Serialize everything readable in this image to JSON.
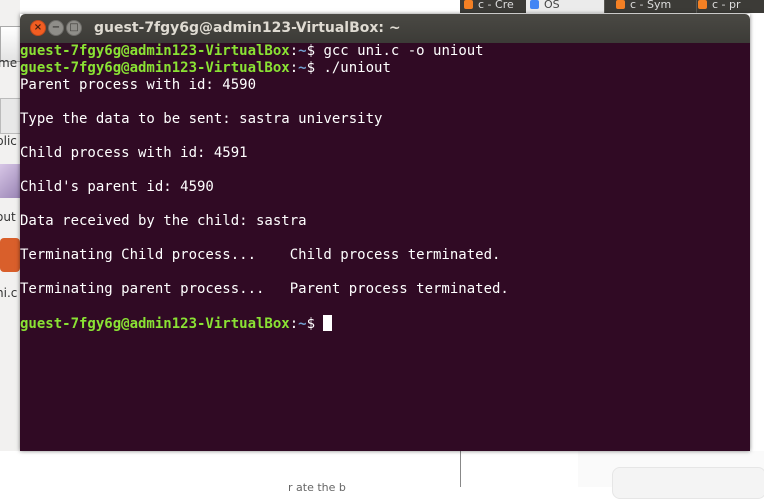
{
  "window": {
    "title": "guest-7fgy6g@admin123-VirtualBox: ~",
    "close_glyph": "×",
    "min_glyph": "−",
    "max_glyph": "□"
  },
  "terminal": {
    "prompt_user_host": "guest-7fgy6g@admin123-VirtualBox",
    "prompt_separator": ":",
    "prompt_path": "~",
    "prompt_symbol": "$ ",
    "commands": [
      "gcc uni.c -o uniout",
      "./uniout"
    ],
    "output": [
      "Parent process with id: 4590",
      "",
      "Type the data to be sent: sastra university",
      "",
      "Child process with id: 4591",
      "",
      "Child's parent id: 4590",
      "",
      "Data received by the child: sastra",
      "",
      "Terminating Child process...    Child process terminated.",
      "",
      "Terminating parent process...   Parent process terminated.",
      ""
    ]
  },
  "background": {
    "desktop_labels": [
      "me",
      "blic",
      "out",
      "ni.c"
    ],
    "browser_tabs": [
      "c - Cre",
      "OS",
      "c - Sym",
      "c - pr"
    ],
    "bottom_text": "r   ate   the   b"
  },
  "colors": {
    "terminal_bg": "#300a24",
    "prompt_green": "#8ae234",
    "prompt_blue": "#729fcf",
    "titlebar": "#3c3b37",
    "close_button": "#f15d22"
  }
}
